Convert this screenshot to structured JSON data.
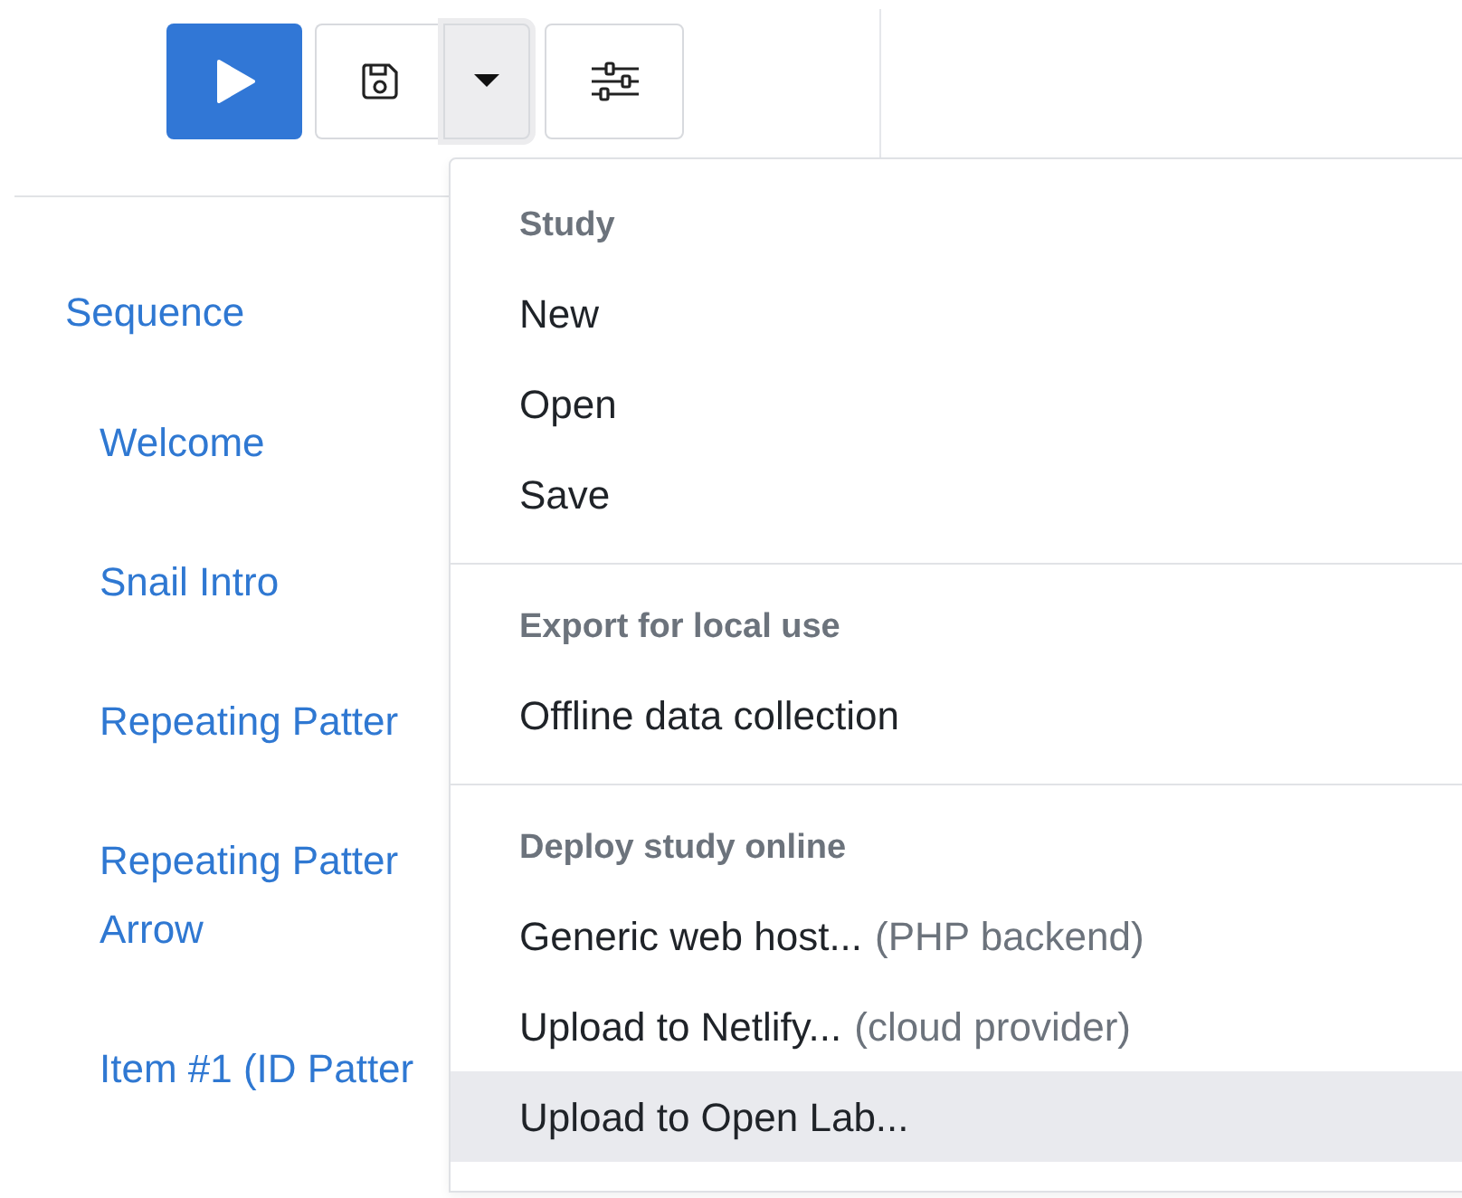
{
  "toolbar": {
    "buttons": [
      {
        "kind": "play"
      },
      {
        "kind": "save"
      },
      {
        "kind": "dropdown",
        "expanded": true
      },
      {
        "kind": "settings"
      }
    ]
  },
  "sidebar": {
    "title": "Sequence",
    "items": [
      {
        "lines": [
          "Welcome"
        ]
      },
      {
        "lines": [
          "Snail Intro"
        ]
      },
      {
        "lines": [
          "Repeating Patter"
        ]
      },
      {
        "lines": [
          "Repeating Patter",
          "Arrow"
        ]
      },
      {
        "lines": [
          "Item #1 (ID Patter"
        ]
      }
    ]
  },
  "menu": {
    "sections": [
      {
        "heading": "Study",
        "items": [
          {
            "label": "New",
            "selected": false
          },
          {
            "label": "Open",
            "selected": false
          },
          {
            "label": "Save",
            "selected": false
          }
        ]
      },
      {
        "heading": "Export for local use",
        "items": [
          {
            "label": "Offline data collection",
            "selected": false
          }
        ]
      },
      {
        "heading": "Deploy study online",
        "items": [
          {
            "label": "Generic web host...",
            "note": "(PHP backend)",
            "selected": false
          },
          {
            "label": "Upload to Netlify...",
            "note": "(cloud provider)",
            "selected": false
          },
          {
            "label": "Upload to Open Lab...",
            "selected": true
          }
        ]
      }
    ]
  }
}
